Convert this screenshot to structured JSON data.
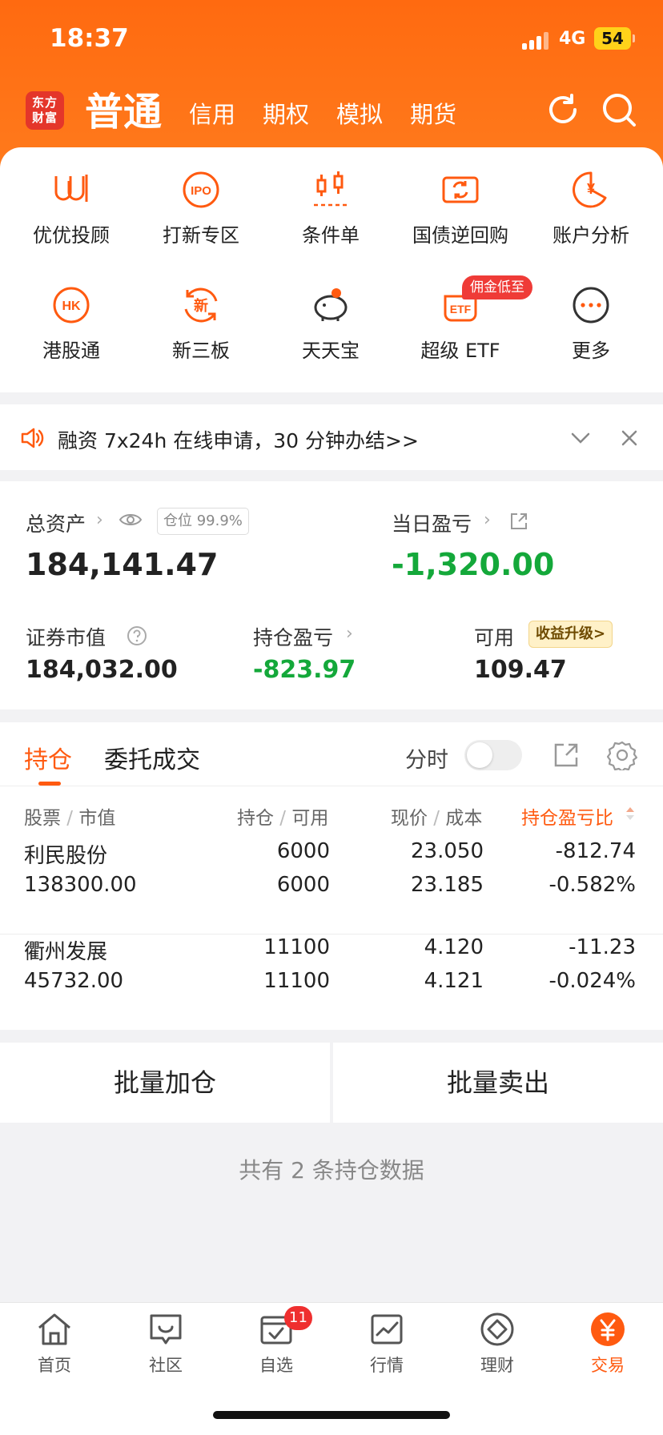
{
  "status_bar": {
    "time": "18:37",
    "network": "4G",
    "battery": "54"
  },
  "header": {
    "logo_line1": "东方",
    "logo_line2": "财富",
    "account_tabs": [
      "普通",
      "信用",
      "期权",
      "模拟",
      "期货"
    ]
  },
  "shortcuts": [
    {
      "label": "优优投顾",
      "icon": "uu-icon"
    },
    {
      "label": "打新专区",
      "icon": "ipo-icon"
    },
    {
      "label": "条件单",
      "icon": "candlestick-icon"
    },
    {
      "label": "国债逆回购",
      "icon": "repo-icon"
    },
    {
      "label": "账户分析",
      "icon": "yuan-chart-icon"
    },
    {
      "label": "港股通",
      "icon": "hk-icon"
    },
    {
      "label": "新三板",
      "icon": "new-icon"
    },
    {
      "label": "天天宝",
      "icon": "piggy-bank-icon"
    },
    {
      "label": "超级 ETF",
      "icon": "etf-icon"
    },
    {
      "label": "更多",
      "icon": "more-icon"
    }
  ],
  "promo_badge": "佣金低至",
  "icon_text": {
    "ipo": "IPO",
    "yuan": "¥",
    "hk": "HK",
    "new": "新",
    "etf": "ETF"
  },
  "notice": {
    "text": "融资 7x24h 在线申请，30 分钟办结>>"
  },
  "assets": {
    "total_label": "总资产",
    "position_tag": "仓位 99.9%",
    "total_value": "184,141.47",
    "daily_pl_label": "当日盈亏",
    "daily_pl_value": "-1,320.00",
    "market_value_label": "证券市值",
    "market_value": "184,032.00",
    "holding_pl_label": "持仓盈亏",
    "holding_pl_value": "-823.97",
    "available_label": "可用",
    "upgrade_tag": "收益升级>",
    "available_value": "109.47"
  },
  "holdings": {
    "tabs": [
      "持仓",
      "委托成交"
    ],
    "timeshare_label": "分时",
    "columns": {
      "stock": "股票",
      "market_value": "市值",
      "position": "持仓",
      "available": "可用",
      "price": "现价",
      "cost": "成本",
      "pl_ratio": "持仓盈亏比"
    },
    "rows": [
      {
        "name": "利民股份",
        "market_value": "138300.00",
        "position": "6000",
        "available": "6000",
        "price": "23.050",
        "cost": "23.185",
        "pl": "-812.74",
        "pl_pct": "-0.582%"
      },
      {
        "name": "衢州发展",
        "market_value": "45732.00",
        "position": "11100",
        "available": "11100",
        "price": "4.120",
        "cost": "4.121",
        "pl": "-11.23",
        "pl_pct": "-0.024%"
      }
    ]
  },
  "batch": {
    "add": "批量加仓",
    "sell": "批量卖出"
  },
  "summary": "共有 2 条持仓数据",
  "tabbar": [
    {
      "label": "首页",
      "icon": "home-icon"
    },
    {
      "label": "社区",
      "icon": "chat-icon"
    },
    {
      "label": "自选",
      "icon": "watchlist-icon",
      "badge": "11"
    },
    {
      "label": "行情",
      "icon": "trend-icon"
    },
    {
      "label": "理财",
      "icon": "diamond-icon"
    },
    {
      "label": "交易",
      "icon": "trade-yuan-icon"
    }
  ],
  "colors": {
    "brand": "#ff6a10",
    "accent": "#ff5a10",
    "loss": "#14a83a",
    "badge": "#ef3b37"
  }
}
